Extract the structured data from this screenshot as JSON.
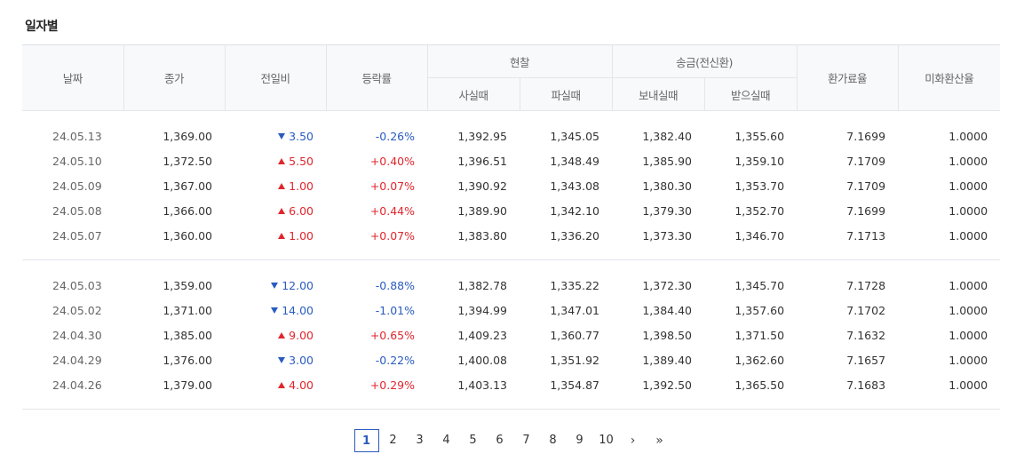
{
  "section": {
    "title": "일자별"
  },
  "table": {
    "headers": {
      "date": "날짜",
      "close": "종가",
      "change": "전일비",
      "rate": "등락률",
      "cash": "현찰",
      "cash_buy": "사실때",
      "cash_sell": "파실때",
      "remit": "송금(전신환)",
      "remit_send": "보내실때",
      "remit_receive": "받으실때",
      "exchange_rate": "환가료율",
      "usd_rate": "미화환산율"
    },
    "groups": [
      {
        "rows": [
          {
            "date": "24.05.13",
            "close": "1,369.00",
            "dir": "down",
            "change": "3.50",
            "rate": "-0.26%",
            "cash_buy": "1,392.95",
            "cash_sell": "1,345.05",
            "remit_send": "1,382.40",
            "remit_receive": "1,355.60",
            "exchange_rate": "7.1699",
            "usd_rate": "1.0000"
          },
          {
            "date": "24.05.10",
            "close": "1,372.50",
            "dir": "up",
            "change": "5.50",
            "rate": "+0.40%",
            "cash_buy": "1,396.51",
            "cash_sell": "1,348.49",
            "remit_send": "1,385.90",
            "remit_receive": "1,359.10",
            "exchange_rate": "7.1709",
            "usd_rate": "1.0000"
          },
          {
            "date": "24.05.09",
            "close": "1,367.00",
            "dir": "up",
            "change": "1.00",
            "rate": "+0.07%",
            "cash_buy": "1,390.92",
            "cash_sell": "1,343.08",
            "remit_send": "1,380.30",
            "remit_receive": "1,353.70",
            "exchange_rate": "7.1709",
            "usd_rate": "1.0000"
          },
          {
            "date": "24.05.08",
            "close": "1,366.00",
            "dir": "up",
            "change": "6.00",
            "rate": "+0.44%",
            "cash_buy": "1,389.90",
            "cash_sell": "1,342.10",
            "remit_send": "1,379.30",
            "remit_receive": "1,352.70",
            "exchange_rate": "7.1699",
            "usd_rate": "1.0000"
          },
          {
            "date": "24.05.07",
            "close": "1,360.00",
            "dir": "up",
            "change": "1.00",
            "rate": "+0.07%",
            "cash_buy": "1,383.80",
            "cash_sell": "1,336.20",
            "remit_send": "1,373.30",
            "remit_receive": "1,346.70",
            "exchange_rate": "7.1713",
            "usd_rate": "1.0000"
          }
        ]
      },
      {
        "rows": [
          {
            "date": "24.05.03",
            "close": "1,359.00",
            "dir": "down",
            "change": "12.00",
            "rate": "-0.88%",
            "cash_buy": "1,382.78",
            "cash_sell": "1,335.22",
            "remit_send": "1,372.30",
            "remit_receive": "1,345.70",
            "exchange_rate": "7.1728",
            "usd_rate": "1.0000"
          },
          {
            "date": "24.05.02",
            "close": "1,371.00",
            "dir": "down",
            "change": "14.00",
            "rate": "-1.01%",
            "cash_buy": "1,394.99",
            "cash_sell": "1,347.01",
            "remit_send": "1,384.40",
            "remit_receive": "1,357.60",
            "exchange_rate": "7.1702",
            "usd_rate": "1.0000"
          },
          {
            "date": "24.04.30",
            "close": "1,385.00",
            "dir": "up",
            "change": "9.00",
            "rate": "+0.65%",
            "cash_buy": "1,409.23",
            "cash_sell": "1,360.77",
            "remit_send": "1,398.50",
            "remit_receive": "1,371.50",
            "exchange_rate": "7.1632",
            "usd_rate": "1.0000"
          },
          {
            "date": "24.04.29",
            "close": "1,376.00",
            "dir": "down",
            "change": "3.00",
            "rate": "-0.22%",
            "cash_buy": "1,400.08",
            "cash_sell": "1,351.92",
            "remit_send": "1,389.40",
            "remit_receive": "1,362.60",
            "exchange_rate": "7.1657",
            "usd_rate": "1.0000"
          },
          {
            "date": "24.04.26",
            "close": "1,379.00",
            "dir": "up",
            "change": "4.00",
            "rate": "+0.29%",
            "cash_buy": "1,403.13",
            "cash_sell": "1,354.87",
            "remit_send": "1,392.50",
            "remit_receive": "1,365.50",
            "exchange_rate": "7.1683",
            "usd_rate": "1.0000"
          }
        ]
      }
    ]
  },
  "pagination": {
    "pages": [
      "1",
      "2",
      "3",
      "4",
      "5",
      "6",
      "7",
      "8",
      "9",
      "10"
    ],
    "active": "1",
    "next_icon": "chevron-right-icon",
    "last_icon": "double-chevron-right-icon",
    "next_label": "›",
    "last_label": "»"
  },
  "colors": {
    "up": "#e0262d",
    "down": "#2a5cbf",
    "active_page": "#2a5cbf"
  }
}
